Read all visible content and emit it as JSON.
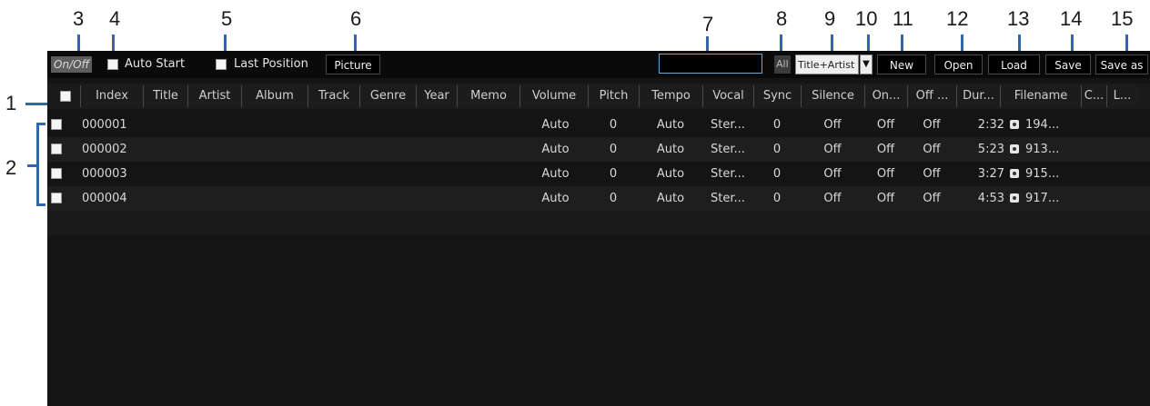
{
  "callouts": [
    "1",
    "2",
    "3",
    "4",
    "5",
    "6",
    "7",
    "8",
    "9",
    "10",
    "11",
    "12",
    "13",
    "14",
    "15"
  ],
  "toolbar": {
    "onoff": "On/Off",
    "auto_start": "Auto Start",
    "last_position": "Last Position",
    "picture": "Picture",
    "search_value": "",
    "all": "All",
    "field_select": "Title+Artist",
    "new": "New",
    "open": "Open",
    "load": "Load",
    "save": "Save",
    "save_as": "Save as"
  },
  "columns": [
    "Index",
    "Title",
    "Artist",
    "Album",
    "Track",
    "Genre",
    "Year",
    "Memo",
    "Volume",
    "Pitch",
    "Tempo",
    "Vocal",
    "Sync",
    "Silence",
    "On...",
    "Off ...",
    "Dur...",
    "Filename",
    "C...",
    "L..."
  ],
  "rows": [
    {
      "index": "000001",
      "volume": "Auto",
      "pitch": "0",
      "tempo": "Auto",
      "vocal": "Ster...",
      "sync": "0",
      "silence": "Off",
      "on": "Off",
      "off": "Off",
      "duration": "2:32",
      "filename": "194..."
    },
    {
      "index": "000002",
      "volume": "Auto",
      "pitch": "0",
      "tempo": "Auto",
      "vocal": "Ster...",
      "sync": "0",
      "silence": "Off",
      "on": "Off",
      "off": "Off",
      "duration": "5:23",
      "filename": "913..."
    },
    {
      "index": "000003",
      "volume": "Auto",
      "pitch": "0",
      "tempo": "Auto",
      "vocal": "Ster...",
      "sync": "0",
      "silence": "Off",
      "on": "Off",
      "off": "Off",
      "duration": "3:27",
      "filename": "915..."
    },
    {
      "index": "000004",
      "volume": "Auto",
      "pitch": "0",
      "tempo": "Auto",
      "vocal": "Ster...",
      "sync": "0",
      "silence": "Off",
      "on": "Off",
      "off": "Off",
      "duration": "4:53",
      "filename": "917..."
    }
  ],
  "colors": {
    "row_dark": "#141414",
    "row_alt": "#1e1e1e",
    "callout_line": "#2f67ad"
  }
}
